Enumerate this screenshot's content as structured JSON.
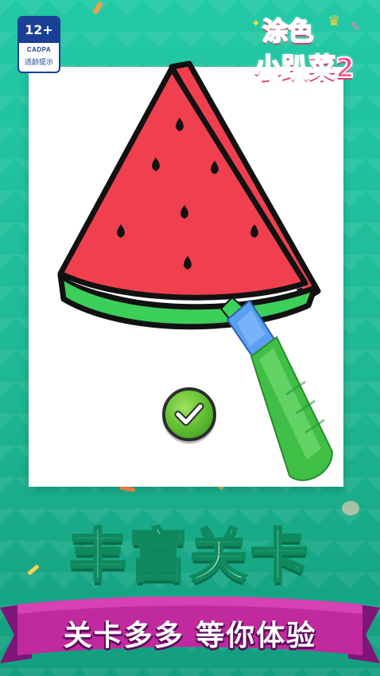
{
  "age_badge": {
    "rating": "12+",
    "org": "CADPA",
    "note": "适龄提示"
  },
  "logo": {
    "line1": "涂色",
    "line2": "小趴菜2"
  },
  "headline": "丰富关卡",
  "ribbon_text": "关卡多多 等你体验",
  "colors": {
    "background": "#22c9a6",
    "watermelon_flesh": "#f0404f",
    "watermelon_rind": "#3ccf5a",
    "marker_body": "#3fbf45",
    "marker_cap": "#5a9ff0",
    "ribbon": "#c02a9e",
    "check_button": "#58b72e"
  },
  "icons": [
    "watermelon-drawing",
    "marker-pen-icon",
    "check-icon"
  ]
}
